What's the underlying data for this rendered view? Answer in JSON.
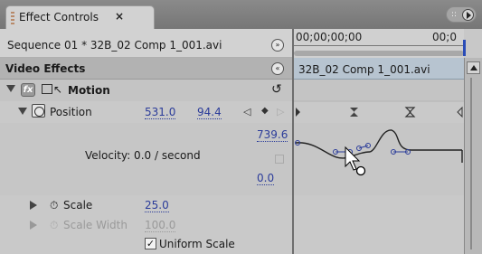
{
  "window": {
    "tab_title": "Effect Controls",
    "tab_close": "×",
    "menu_grip": "::"
  },
  "left_panel": {
    "sequence_label": "Sequence 01 * 32B_02 Comp 1_001.avi",
    "sequence_toggle_glyph": "»",
    "section_title": "Video Effects",
    "section_toggle_glyph": "«",
    "motion": {
      "label": "Motion",
      "fx_glyph": "fx",
      "reset_glyph": "↺"
    },
    "position": {
      "label": "Position",
      "x": "531.0",
      "y": "94.4",
      "kf_prev": "◁",
      "kf_add": "◆",
      "kf_next": "▷"
    },
    "velocity": {
      "label": "Velocity: 0.0 / second",
      "max": "739.6",
      "min": "0.0"
    },
    "scale": {
      "label": "Scale",
      "value": "25.0",
      "stopwatch_glyph": "⏱"
    },
    "scale_width": {
      "label": "Scale Width",
      "value": "100.0",
      "stopwatch_glyph": "⏱"
    },
    "uniform_scale": {
      "label": "Uniform Scale",
      "checked": true,
      "check_glyph": "✓"
    }
  },
  "timeline": {
    "timecode_start": "00;00;00;00",
    "timecode_end": "00;0",
    "clip_label": "32B_02 Comp 1_001.avi"
  },
  "colors": {
    "value_link": "#2b3c9a",
    "clip_bar": "#b7c4d0",
    "playhead": "#2a4cb8"
  }
}
